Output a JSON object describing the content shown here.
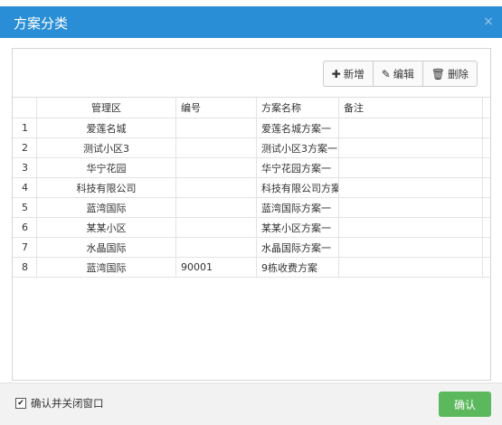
{
  "dialog": {
    "title": "方案分类",
    "close_glyph": "×"
  },
  "toolbar": {
    "add": {
      "icon": "plus-icon",
      "glyph": "✚",
      "label": "新增"
    },
    "edit": {
      "icon": "edit-icon",
      "glyph": "✎",
      "label": "编辑"
    },
    "delete": {
      "icon": "trash-icon",
      "glyph": "🗑",
      "label": "删除"
    }
  },
  "table": {
    "headers": [
      "",
      "管理区",
      "编号",
      "方案名称",
      "备注"
    ],
    "rows": [
      [
        "1",
        "爱莲名城",
        "",
        "爱莲名城方案一",
        ""
      ],
      [
        "2",
        "测试小区3",
        "",
        "测试小区3方案一",
        ""
      ],
      [
        "3",
        "华宁花园",
        "",
        "华宁花园方案一",
        ""
      ],
      [
        "4",
        "科技有限公司",
        "",
        "科技有限公司方案",
        ""
      ],
      [
        "5",
        "蓝湾国际",
        "",
        "蓝湾国际方案一",
        ""
      ],
      [
        "6",
        "某某小区",
        "",
        "某某小区方案一",
        ""
      ],
      [
        "7",
        "水晶国际",
        "",
        "水晶国际方案一",
        ""
      ],
      [
        "8",
        "蓝湾国际",
        "90001",
        "9栋收费方案",
        ""
      ]
    ]
  },
  "footer": {
    "checkbox_checked": true,
    "checkbox_label": "确认并关闭窗口",
    "confirm_label": "确认"
  },
  "colors": {
    "titlebar": "#2a8ed6",
    "confirm_button": "#5cb85c"
  }
}
